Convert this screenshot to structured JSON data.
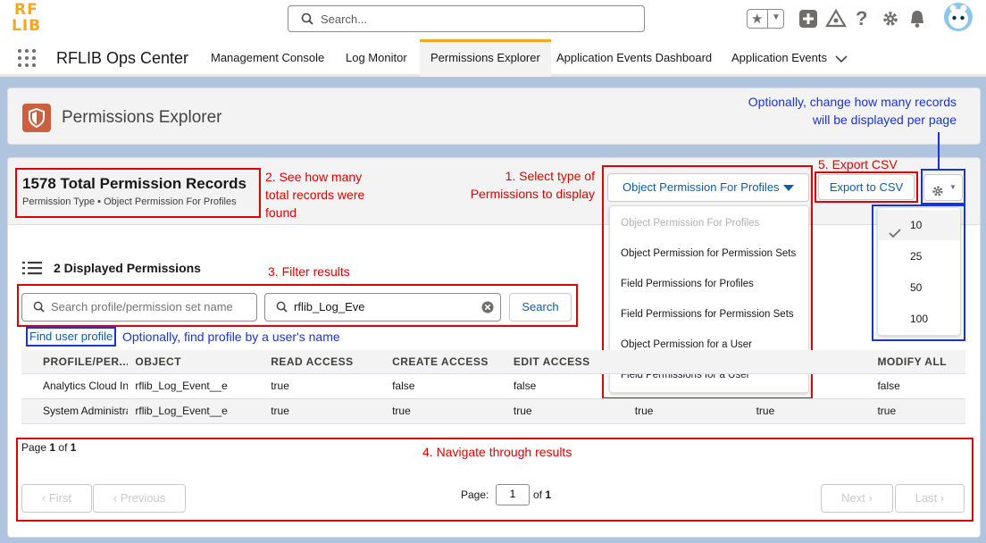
{
  "header": {
    "logo_line1": "RF",
    "logo_line2": "LIB",
    "search_placeholder": "Search..."
  },
  "nav": {
    "app_name": "RFLIB Ops Center",
    "tabs": [
      {
        "label": "Management Console"
      },
      {
        "label": "Log Monitor"
      },
      {
        "label": "Permissions Explorer"
      },
      {
        "label": "Application Events Dashboard"
      },
      {
        "label": "Application Events"
      }
    ]
  },
  "page": {
    "title": "Permissions Explorer"
  },
  "summary": {
    "total_title": "1578 Total Permission Records",
    "subtitle": "Permission Type • Object Permission For Profiles"
  },
  "annotations": {
    "note2": [
      "2. See how many",
      "total records were",
      "found"
    ],
    "note1": [
      "1. Select type of",
      "Permissions to display"
    ],
    "note5": "5. Export CSV",
    "note_page_size": [
      "Optionally, change how many records",
      "will be displayed per page"
    ],
    "note3": "3. Filter results",
    "note_find": "Optionally, find profile by a user's name",
    "note4": "4. Navigate through results"
  },
  "permission_type": {
    "selected": "Object Permission For Profiles",
    "options": [
      "Object Permission For Profiles",
      "Object Permission for Permission Sets",
      "Field Permissions for Profiles",
      "Field Permissions for Permission Sets",
      "Object Permission for a User",
      "Field Permissions for a User"
    ]
  },
  "export_label": "Export to CSV",
  "page_size": {
    "selected": "10",
    "options": [
      "10",
      "25",
      "50",
      "100"
    ]
  },
  "displayed": {
    "title": "2 Displayed Permissions"
  },
  "filters": {
    "profile_placeholder": "Search profile/permission set name",
    "object_value": "rflib_Log_Eve",
    "search_button": "Search",
    "find_user_link": "Find user profile"
  },
  "table": {
    "columns": [
      "PROFILE/PER...",
      "OBJECT",
      "READ ACCESS",
      "CREATE ACCESS",
      "EDIT ACCESS",
      "",
      "",
      "MODIFY ALL"
    ],
    "rows": [
      [
        "Analytics Cloud Integration User",
        "rflib_Log_Event__e",
        "true",
        "false",
        "false",
        "",
        "",
        "false"
      ],
      [
        "System Administrator",
        "rflib_Log_Event__e",
        "true",
        "true",
        "true",
        "true",
        "true",
        "true"
      ]
    ]
  },
  "pager": {
    "page_label": "Page",
    "current": "1",
    "of_label": "of",
    "total": "1",
    "page_input_label": "Page:",
    "first": "First",
    "previous": "Previous",
    "next": "Next",
    "last": "Last"
  },
  "colors": {
    "accent": "#f4a623",
    "link": "#0b5cab",
    "annotation_red": "#e00000",
    "annotation_blue": "#1a33d6",
    "page_icon": "#c9613f"
  }
}
